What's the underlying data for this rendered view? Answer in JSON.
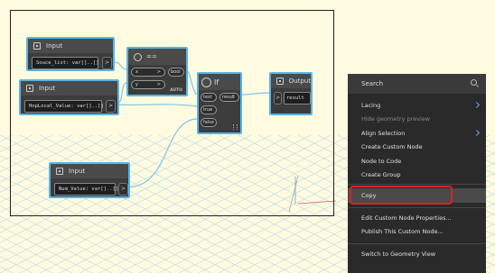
{
  "colors": {
    "node_border": "#5ab4e6",
    "node_body": "#3c3c3c",
    "menu_bg": "#2a2a2a",
    "highlight_outline": "#e0202a",
    "canvas_bg": "#fffbe0"
  },
  "nodes": {
    "input1": {
      "title": "Input",
      "value": "Souce_list: var[]..[]",
      "port": ">"
    },
    "input2": {
      "title": "Input",
      "value": "HopLocal_Value: var[]..[]",
      "port": ">"
    },
    "input3": {
      "title": "Input",
      "value": "Num_Value: var[]..[]",
      "port": ">"
    },
    "equals": {
      "title": "==",
      "in_x": "x",
      "in_y": "y",
      "out": "bool",
      "in_x_arrow": ">",
      "in_y_arrow": ">",
      "lacing": "AUTO"
    },
    "if": {
      "title": "If",
      "in_test": "test",
      "in_true": "true",
      "in_false": "false",
      "out": "result"
    },
    "output": {
      "title": "Output",
      "value": "result",
      "port": ">"
    }
  },
  "menu": {
    "search_placeholder": "Search",
    "items": [
      {
        "label": "Lacing",
        "submenu": true,
        "enabled": true
      },
      {
        "label": "Hide geometry preview",
        "submenu": false,
        "enabled": false
      },
      {
        "label": "Align Selection",
        "submenu": true,
        "enabled": true
      },
      {
        "label": "Create Custom Node",
        "submenu": false,
        "enabled": true
      },
      {
        "label": "Node to Code",
        "submenu": false,
        "enabled": true
      },
      {
        "label": "Create Group",
        "submenu": false,
        "enabled": true
      },
      {
        "label": "Copy",
        "submenu": false,
        "enabled": true,
        "highlighted": true
      },
      {
        "label": "Edit Custom Node Properties...",
        "submenu": false,
        "enabled": true
      },
      {
        "label": "Publish This Custom Node...",
        "submenu": false,
        "enabled": true
      },
      {
        "label": "Switch to Geometry View",
        "submenu": false,
        "enabled": true
      }
    ]
  }
}
